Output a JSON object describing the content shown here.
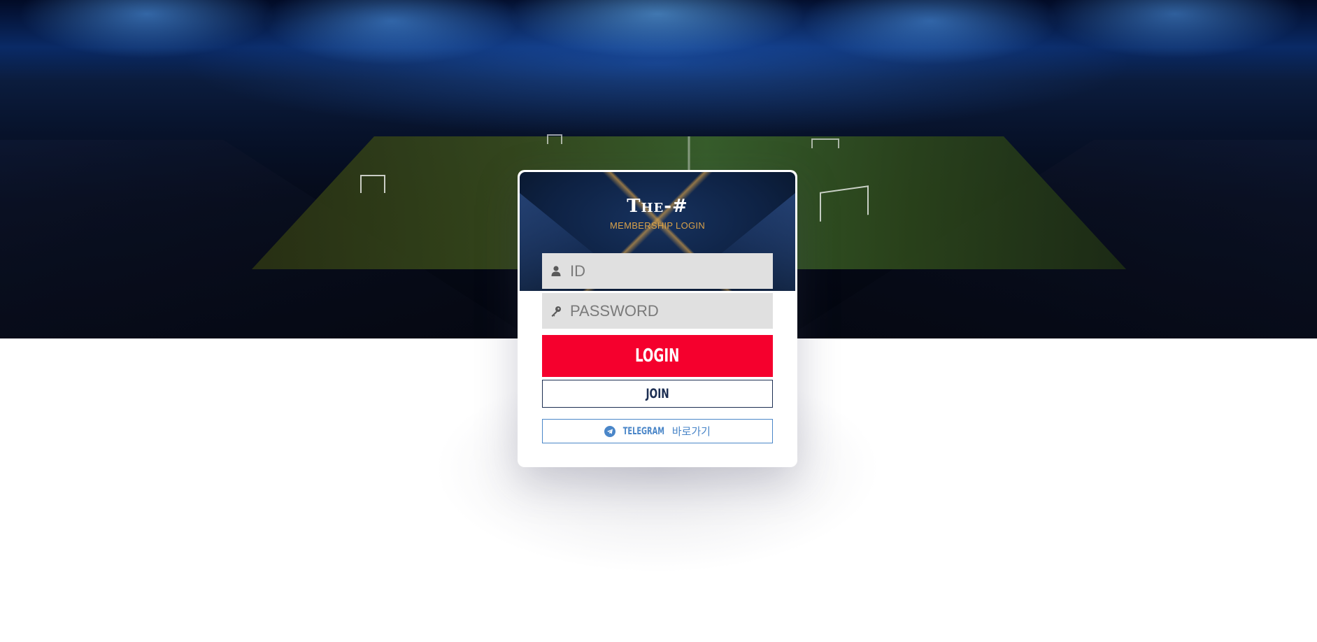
{
  "brand": {
    "title": "The-#",
    "subtitle": "MEMBERSHIP LOGIN"
  },
  "form": {
    "id_placeholder": "ID",
    "id_icon": "user-icon",
    "password_placeholder": "PASSWORD",
    "password_icon": "key-icon"
  },
  "buttons": {
    "login_label": "LOGIN",
    "join_label": "JOIN",
    "telegram_brand": "TELEGRAM",
    "telegram_label": "바로가기",
    "telegram_icon": "telegram-icon"
  },
  "colors": {
    "login_button": "#f5002d",
    "join_border": "#1c2e52",
    "telegram_accent": "#4a86c8",
    "subtitle_gold": "#d9a24a"
  }
}
